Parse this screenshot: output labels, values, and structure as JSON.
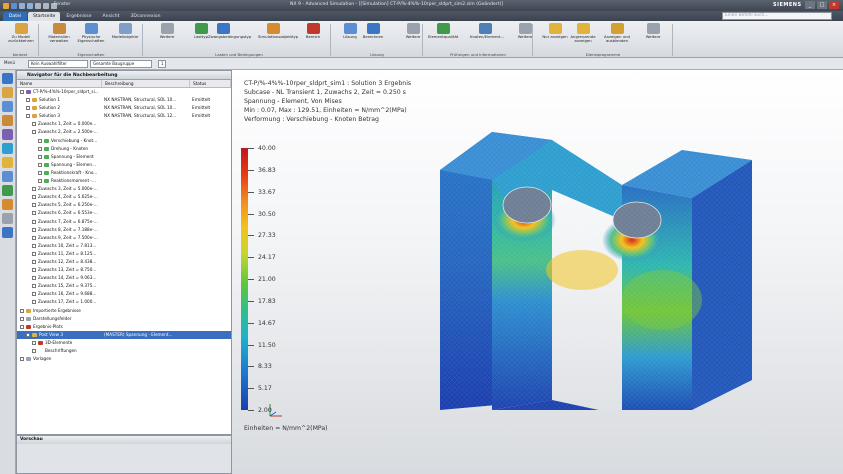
{
  "titlebar": {
    "icons": [
      "app-logo-icon",
      "save-icon",
      "undo-icon",
      "redo-icon",
      "cut-icon",
      "copy-icon",
      "paste-icon"
    ],
    "switch_window": "Fenster",
    "window_title": "NX 9 - Advanced Simulation - [[Simulation] CT-P/%-4%%-10rper_sldprt_sim2.sim (Geändert)]",
    "brand": "SIEMENS"
  },
  "tabs": [
    {
      "label": "Datei",
      "kind": "datei"
    },
    {
      "label": "Startseite",
      "kind": "active"
    },
    {
      "label": "Ergebnisse",
      "kind": ""
    },
    {
      "label": "Ansicht",
      "kind": ""
    },
    {
      "label": "3Dconnexion",
      "kind": ""
    }
  ],
  "search_placeholder": "Einen Befehl such...",
  "ribbon": {
    "buttons": [
      {
        "label": "Zu Modell zurückkehren",
        "icon": "return-to-model-icon",
        "color": "#d9a441"
      },
      {
        "label": "Materialien verwalten",
        "icon": "materials-icon",
        "color": "#c98a3a"
      },
      {
        "label": "Physische Eigenschaften",
        "icon": "physical-properties-icon",
        "color": "#5b8fd1"
      },
      {
        "label": "Modellobjekte",
        "icon": "model-objects-icon",
        "color": "#7f9fc9"
      },
      {
        "label": "Weitere",
        "icon": "more-icon",
        "color": "#9aa3ad"
      },
      {
        "label": "Lasttyp",
        "icon": "load-type-icon",
        "color": "#3f9a4b"
      },
      {
        "label": "Zwangsbedingungstyp",
        "icon": "constraint-type-icon",
        "color": "#3b75c4"
      },
      {
        "label": "Simulationsobjekttyp",
        "icon": "simulation-object-icon",
        "color": "#d58c2f"
      },
      {
        "label": "Bereich",
        "icon": "region-icon",
        "color": "#c0392b"
      },
      {
        "label": "Lösung",
        "icon": "solution-icon",
        "color": "#5b8fd1"
      },
      {
        "label": "Berechnen",
        "icon": "solve-icon",
        "color": "#3b75c4"
      },
      {
        "label": "Weitere",
        "icon": "more-icon",
        "color": "#9aa3ad"
      },
      {
        "label": "Elementqualität",
        "icon": "element-quality-icon",
        "color": "#3f9a4b"
      },
      {
        "label": "Knoten/Element...",
        "icon": "node-element-icon",
        "color": "#4f7fb8"
      },
      {
        "label": "Weitere",
        "icon": "more-icon",
        "color": "#9aa3ad"
      },
      {
        "label": "Nur anzeigen",
        "icon": "show-only-icon",
        "color": "#e0b43a"
      },
      {
        "label": "Angrenzende anzeigen",
        "icon": "show-adjacent-icon",
        "color": "#e0b43a"
      },
      {
        "label": "Anzeigen und ausblenden",
        "icon": "show-hide-icon",
        "color": "#d4a030"
      },
      {
        "label": "Weitere",
        "icon": "more-icon",
        "color": "#9aa3ad"
      }
    ],
    "groups": [
      "Kontext",
      "Eigenschaften",
      "Lasten und Bedingungen",
      "Lösung",
      "Prüfungen und Informationen",
      "Dienstprogramme"
    ]
  },
  "filterbar": {
    "menu": "Menü",
    "filter": "Kein Auswahlfilter",
    "scope": "Gesamte Baugruppe",
    "layer": "1"
  },
  "left_tools": [
    "navigator-icon",
    "part-icon",
    "simulation-icon",
    "history-icon",
    "roles-icon",
    "web-icon",
    "palette-icon",
    "clock-icon",
    "results-icon",
    "reuse-icon",
    "system-icon",
    "help-icon"
  ],
  "navigator": {
    "title": "Navigator für die Nachbearbeitung",
    "columns": [
      "Name",
      "Beschreibung",
      "Status"
    ],
    "rows": [
      {
        "indent": 0,
        "name": "CT-P/%-4%%-10rper_sldprt_si...",
        "desc": "",
        "status": "",
        "icon": "#7c5fb0",
        "sel": false
      },
      {
        "indent": 1,
        "name": "Solution 1",
        "desc": "NX NASTRAN, Structural, SOL 10...",
        "status": "Ermittelt",
        "icon": "#d9a441",
        "sel": false
      },
      {
        "indent": 1,
        "name": "Solution 2",
        "desc": "NX NASTRAN, Structural, SOL 10...",
        "status": "Ermittelt",
        "icon": "#d9a441",
        "sel": false
      },
      {
        "indent": 1,
        "name": "Solution 3",
        "desc": "NX NASTRAN, Structural, SOL 12...",
        "status": "Ermittelt",
        "icon": "#d9a441",
        "sel": false
      },
      {
        "indent": 2,
        "name": "Zuwachs 1, Zeit = 0.000e...",
        "desc": "",
        "status": "",
        "icon": "",
        "sel": false
      },
      {
        "indent": 2,
        "name": "Zuwachs 2, Zeit = 2.500e-...",
        "desc": "",
        "status": "",
        "icon": "",
        "sel": false
      },
      {
        "indent": 3,
        "name": "Verschiebung - Knot...",
        "desc": "",
        "status": "",
        "icon": "#4caf50",
        "sel": false
      },
      {
        "indent": 3,
        "name": "Drehung - Knoten",
        "desc": "",
        "status": "",
        "icon": "#4caf50",
        "sel": false
      },
      {
        "indent": 3,
        "name": "Spannung - Element",
        "desc": "",
        "status": "",
        "icon": "#4caf50",
        "sel": false
      },
      {
        "indent": 3,
        "name": "Spannung - Elemen...",
        "desc": "",
        "status": "",
        "icon": "#4caf50",
        "sel": false
      },
      {
        "indent": 3,
        "name": "Reaktionskraft - Kno...",
        "desc": "",
        "status": "",
        "icon": "#4caf50",
        "sel": false
      },
      {
        "indent": 3,
        "name": "Reaktionsmoment -...",
        "desc": "",
        "status": "",
        "icon": "#4caf50",
        "sel": false
      },
      {
        "indent": 2,
        "name": "Zuwachs 3, Zeit = 5.000e-...",
        "desc": "",
        "status": "",
        "icon": "",
        "sel": false
      },
      {
        "indent": 2,
        "name": "Zuwachs 4, Zeit = 5.625e-...",
        "desc": "",
        "status": "",
        "icon": "",
        "sel": false
      },
      {
        "indent": 2,
        "name": "Zuwachs 5, Zeit = 6.250e-...",
        "desc": "",
        "status": "",
        "icon": "",
        "sel": false
      },
      {
        "indent": 2,
        "name": "Zuwachs 6, Zeit = 6.553e-...",
        "desc": "",
        "status": "",
        "icon": "",
        "sel": false
      },
      {
        "indent": 2,
        "name": "Zuwachs 7, Zeit = 6.875e-...",
        "desc": "",
        "status": "",
        "icon": "",
        "sel": false
      },
      {
        "indent": 2,
        "name": "Zuwachs 8, Zeit = 7.188e-...",
        "desc": "",
        "status": "",
        "icon": "",
        "sel": false
      },
      {
        "indent": 2,
        "name": "Zuwachs 9, Zeit = 7.500e-...",
        "desc": "",
        "status": "",
        "icon": "",
        "sel": false
      },
      {
        "indent": 2,
        "name": "Zuwachs 10, Zeit = 7.813...",
        "desc": "",
        "status": "",
        "icon": "",
        "sel": false
      },
      {
        "indent": 2,
        "name": "Zuwachs 11, Zeit = 8.125...",
        "desc": "",
        "status": "",
        "icon": "",
        "sel": false
      },
      {
        "indent": 2,
        "name": "Zuwachs 12, Zeit = 8.438...",
        "desc": "",
        "status": "",
        "icon": "",
        "sel": false
      },
      {
        "indent": 2,
        "name": "Zuwachs 13, Zeit = 8.750...",
        "desc": "",
        "status": "",
        "icon": "",
        "sel": false
      },
      {
        "indent": 2,
        "name": "Zuwachs 14, Zeit = 9.063...",
        "desc": "",
        "status": "",
        "icon": "",
        "sel": false
      },
      {
        "indent": 2,
        "name": "Zuwachs 15, Zeit = 9.375...",
        "desc": "",
        "status": "",
        "icon": "",
        "sel": false
      },
      {
        "indent": 2,
        "name": "Zuwachs 16, Zeit = 9.688...",
        "desc": "",
        "status": "",
        "icon": "",
        "sel": false
      },
      {
        "indent": 2,
        "name": "Zuwachs 17, Zeit = 1.000...",
        "desc": "",
        "status": "",
        "icon": "",
        "sel": false
      },
      {
        "indent": 0,
        "name": "Importierte Ergebnisse",
        "desc": "",
        "status": "",
        "icon": "#d9a441",
        "sel": false
      },
      {
        "indent": 0,
        "name": "Darstellungsfelder",
        "desc": "",
        "status": "",
        "icon": "#9aa3ad",
        "sel": false
      },
      {
        "indent": 0,
        "name": "Ergebnis-Plots",
        "desc": "",
        "status": "",
        "icon": "#c0392b",
        "sel": false
      },
      {
        "indent": 1,
        "name": "Post View 3",
        "desc": "(MASTER) Spannung - Element...",
        "status": "",
        "icon": "#e0b43a",
        "sel": true
      },
      {
        "indent": 2,
        "name": "3D-Elemente",
        "desc": "",
        "status": "",
        "icon": "#c0392b",
        "sel": false
      },
      {
        "indent": 2,
        "name": "Beschriftungen",
        "desc": "",
        "status": "",
        "icon": "#ffffff",
        "sel": false
      },
      {
        "indent": 0,
        "name": "Vorlagen",
        "desc": "",
        "status": "",
        "icon": "#9aa3ad",
        "sel": false
      }
    ]
  },
  "preview_title": "Vorschau",
  "result": {
    "line1": "CT-P/%-4%%-10rper_sldprt_sim1 : Solution 3 Ergebnis",
    "line2": "Subcase - NL Transient 1, Zuwachs 2, Zeit = 0.250 s",
    "line3": "Spannung - Element, Von Mises",
    "line4": "Min : 0.07, Max : 129.51, Einheiten = N/mm^2(MPa)",
    "line5": "Verformung : Verschiebung - Knoten Betrag",
    "legend": [
      "40.00",
      "36.83",
      "33.67",
      "30.50",
      "27.33",
      "24.17",
      "21.00",
      "17.83",
      "14.67",
      "11.50",
      "8.33",
      "5.17",
      "2.00"
    ],
    "units": "Einheiten = N/mm^2(MPa)"
  }
}
